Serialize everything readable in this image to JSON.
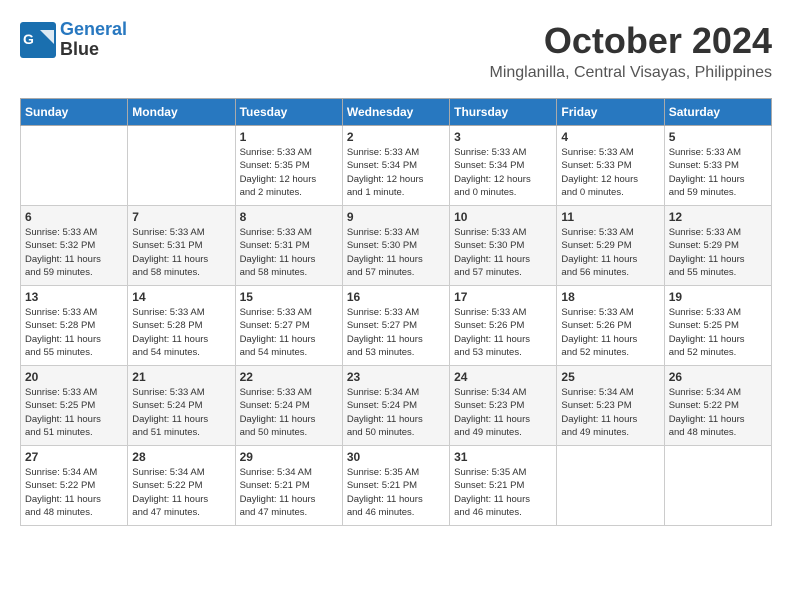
{
  "header": {
    "logo_line1": "General",
    "logo_line2": "Blue",
    "month": "October 2024",
    "location": "Minglanilla, Central Visayas, Philippines"
  },
  "days_of_week": [
    "Sunday",
    "Monday",
    "Tuesday",
    "Wednesday",
    "Thursday",
    "Friday",
    "Saturday"
  ],
  "weeks": [
    [
      {
        "day": "",
        "info": ""
      },
      {
        "day": "",
        "info": ""
      },
      {
        "day": "1",
        "info": "Sunrise: 5:33 AM\nSunset: 5:35 PM\nDaylight: 12 hours\nand 2 minutes."
      },
      {
        "day": "2",
        "info": "Sunrise: 5:33 AM\nSunset: 5:34 PM\nDaylight: 12 hours\nand 1 minute."
      },
      {
        "day": "3",
        "info": "Sunrise: 5:33 AM\nSunset: 5:34 PM\nDaylight: 12 hours\nand 0 minutes."
      },
      {
        "day": "4",
        "info": "Sunrise: 5:33 AM\nSunset: 5:33 PM\nDaylight: 12 hours\nand 0 minutes."
      },
      {
        "day": "5",
        "info": "Sunrise: 5:33 AM\nSunset: 5:33 PM\nDaylight: 11 hours\nand 59 minutes."
      }
    ],
    [
      {
        "day": "6",
        "info": "Sunrise: 5:33 AM\nSunset: 5:32 PM\nDaylight: 11 hours\nand 59 minutes."
      },
      {
        "day": "7",
        "info": "Sunrise: 5:33 AM\nSunset: 5:31 PM\nDaylight: 11 hours\nand 58 minutes."
      },
      {
        "day": "8",
        "info": "Sunrise: 5:33 AM\nSunset: 5:31 PM\nDaylight: 11 hours\nand 58 minutes."
      },
      {
        "day": "9",
        "info": "Sunrise: 5:33 AM\nSunset: 5:30 PM\nDaylight: 11 hours\nand 57 minutes."
      },
      {
        "day": "10",
        "info": "Sunrise: 5:33 AM\nSunset: 5:30 PM\nDaylight: 11 hours\nand 57 minutes."
      },
      {
        "day": "11",
        "info": "Sunrise: 5:33 AM\nSunset: 5:29 PM\nDaylight: 11 hours\nand 56 minutes."
      },
      {
        "day": "12",
        "info": "Sunrise: 5:33 AM\nSunset: 5:29 PM\nDaylight: 11 hours\nand 55 minutes."
      }
    ],
    [
      {
        "day": "13",
        "info": "Sunrise: 5:33 AM\nSunset: 5:28 PM\nDaylight: 11 hours\nand 55 minutes."
      },
      {
        "day": "14",
        "info": "Sunrise: 5:33 AM\nSunset: 5:28 PM\nDaylight: 11 hours\nand 54 minutes."
      },
      {
        "day": "15",
        "info": "Sunrise: 5:33 AM\nSunset: 5:27 PM\nDaylight: 11 hours\nand 54 minutes."
      },
      {
        "day": "16",
        "info": "Sunrise: 5:33 AM\nSunset: 5:27 PM\nDaylight: 11 hours\nand 53 minutes."
      },
      {
        "day": "17",
        "info": "Sunrise: 5:33 AM\nSunset: 5:26 PM\nDaylight: 11 hours\nand 53 minutes."
      },
      {
        "day": "18",
        "info": "Sunrise: 5:33 AM\nSunset: 5:26 PM\nDaylight: 11 hours\nand 52 minutes."
      },
      {
        "day": "19",
        "info": "Sunrise: 5:33 AM\nSunset: 5:25 PM\nDaylight: 11 hours\nand 52 minutes."
      }
    ],
    [
      {
        "day": "20",
        "info": "Sunrise: 5:33 AM\nSunset: 5:25 PM\nDaylight: 11 hours\nand 51 minutes."
      },
      {
        "day": "21",
        "info": "Sunrise: 5:33 AM\nSunset: 5:24 PM\nDaylight: 11 hours\nand 51 minutes."
      },
      {
        "day": "22",
        "info": "Sunrise: 5:33 AM\nSunset: 5:24 PM\nDaylight: 11 hours\nand 50 minutes."
      },
      {
        "day": "23",
        "info": "Sunrise: 5:34 AM\nSunset: 5:24 PM\nDaylight: 11 hours\nand 50 minutes."
      },
      {
        "day": "24",
        "info": "Sunrise: 5:34 AM\nSunset: 5:23 PM\nDaylight: 11 hours\nand 49 minutes."
      },
      {
        "day": "25",
        "info": "Sunrise: 5:34 AM\nSunset: 5:23 PM\nDaylight: 11 hours\nand 49 minutes."
      },
      {
        "day": "26",
        "info": "Sunrise: 5:34 AM\nSunset: 5:22 PM\nDaylight: 11 hours\nand 48 minutes."
      }
    ],
    [
      {
        "day": "27",
        "info": "Sunrise: 5:34 AM\nSunset: 5:22 PM\nDaylight: 11 hours\nand 48 minutes."
      },
      {
        "day": "28",
        "info": "Sunrise: 5:34 AM\nSunset: 5:22 PM\nDaylight: 11 hours\nand 47 minutes."
      },
      {
        "day": "29",
        "info": "Sunrise: 5:34 AM\nSunset: 5:21 PM\nDaylight: 11 hours\nand 47 minutes."
      },
      {
        "day": "30",
        "info": "Sunrise: 5:35 AM\nSunset: 5:21 PM\nDaylight: 11 hours\nand 46 minutes."
      },
      {
        "day": "31",
        "info": "Sunrise: 5:35 AM\nSunset: 5:21 PM\nDaylight: 11 hours\nand 46 minutes."
      },
      {
        "day": "",
        "info": ""
      },
      {
        "day": "",
        "info": ""
      }
    ]
  ]
}
